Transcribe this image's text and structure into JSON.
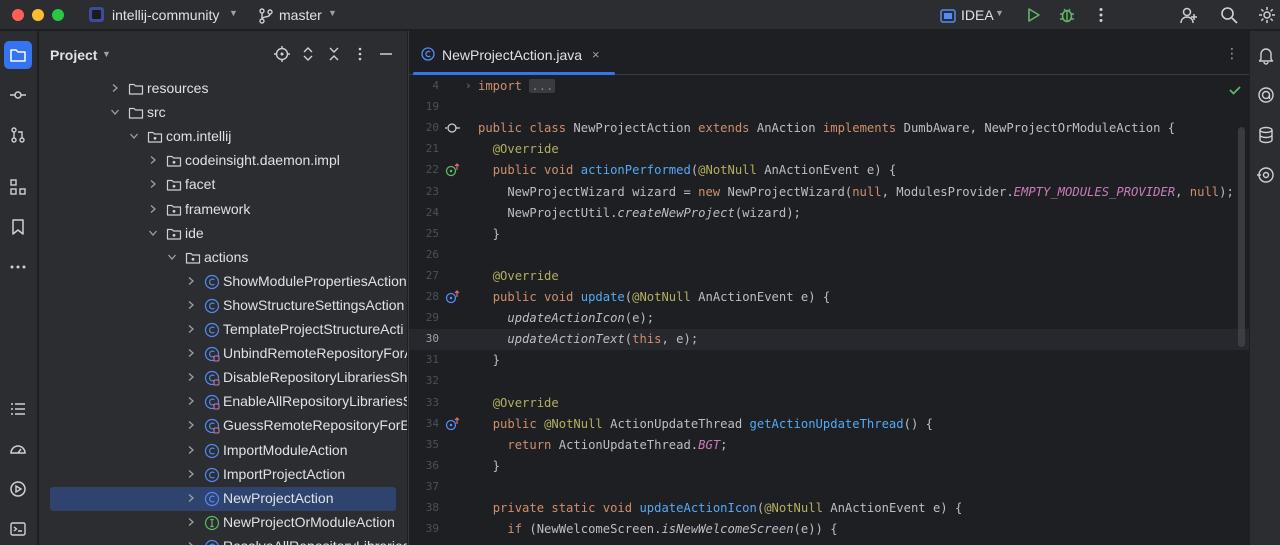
{
  "titlebar": {
    "project_name": "intellij-community",
    "branch": "master",
    "run_config": "IDEA"
  },
  "project_panel": {
    "title": "Project",
    "tree": [
      {
        "label": "resources",
        "icon": "folder-icon",
        "depth": 0,
        "arrow": "collapsed"
      },
      {
        "label": "src",
        "icon": "folder-icon",
        "depth": 0,
        "arrow": "expanded"
      },
      {
        "label": "com.intellij",
        "icon": "package-icon",
        "depth": 1,
        "arrow": "expanded"
      },
      {
        "label": "codeinsight.daemon.impl",
        "icon": "package-icon",
        "depth": 2,
        "arrow": "collapsed"
      },
      {
        "label": "facet",
        "icon": "package-icon",
        "depth": 2,
        "arrow": "collapsed"
      },
      {
        "label": "framework",
        "icon": "package-icon",
        "depth": 2,
        "arrow": "collapsed"
      },
      {
        "label": "ide",
        "icon": "package-icon",
        "depth": 2,
        "arrow": "expanded"
      },
      {
        "label": "actions",
        "icon": "package-icon",
        "depth": 3,
        "arrow": "expanded"
      },
      {
        "label": "ShowModulePropertiesAction",
        "icon": "class-icon",
        "depth": 4,
        "arrow": "collapsed"
      },
      {
        "label": "ShowStructureSettingsAction",
        "icon": "class-icon",
        "depth": 4,
        "arrow": "collapsed"
      },
      {
        "label": "TemplateProjectStructureActi",
        "icon": "class-icon",
        "depth": 4,
        "arrow": "collapsed"
      },
      {
        "label": "UnbindRemoteRepositoryForA",
        "icon": "class-locked-icon",
        "depth": 4,
        "arrow": "collapsed"
      },
      {
        "label": "DisableRepositoryLibrariesSha",
        "icon": "class-locked-icon",
        "depth": 4,
        "arrow": "collapsed"
      },
      {
        "label": "EnableAllRepositoryLibrariesS",
        "icon": "class-locked-icon",
        "depth": 4,
        "arrow": "collapsed"
      },
      {
        "label": "GuessRemoteRepositoryForEa",
        "icon": "class-locked-icon",
        "depth": 4,
        "arrow": "collapsed"
      },
      {
        "label": "ImportModuleAction",
        "icon": "class-icon",
        "depth": 4,
        "arrow": "collapsed"
      },
      {
        "label": "ImportProjectAction",
        "icon": "class-icon",
        "depth": 4,
        "arrow": "collapsed"
      },
      {
        "label": "NewProjectAction",
        "icon": "class-icon",
        "depth": 4,
        "arrow": "collapsed",
        "selected": true
      },
      {
        "label": "NewProjectOrModuleAction",
        "icon": "interface-icon",
        "depth": 4,
        "arrow": "collapsed"
      },
      {
        "label": "ResolveAllRepositoryLibraries",
        "icon": "class-locked-icon",
        "depth": 4,
        "arrow": "collapsed"
      }
    ]
  },
  "editor": {
    "tab_label": "NewProjectAction.java",
    "tab_close": "×",
    "current_line": "30",
    "lines": [
      {
        "n": "4",
        "gutter": "",
        "fold": "›",
        "html": "<span class=\"kw\">import</span> <span class=\"cm\">...</span>"
      },
      {
        "n": "19",
        "gutter": "",
        "html": ""
      },
      {
        "n": "20",
        "gutter": "implements",
        "html": "<span class=\"kw\">public class</span> NewProjectAction <span class=\"kw\">extends</span> AnAction <span class=\"kw\">implements</span> DumbAware, NewProjectOrModuleAction {"
      },
      {
        "n": "21",
        "gutter": "",
        "html": "  <span class=\"an\">@Override</span>"
      },
      {
        "n": "22",
        "gutter": "override-green",
        "html": "  <span class=\"kw\">public void</span> <span class=\"fn\">actionPerformed</span>(<span class=\"an\">@NotNull</span> AnActionEvent e) {"
      },
      {
        "n": "23",
        "gutter": "",
        "html": "    NewProjectWizard wizard = <span class=\"kw\">new</span> NewProjectWizard(<span class=\"kw\">null</span>, ModulesProvider.<span class=\"st\">EMPTY_MODULES_PROVIDER</span>, <span class=\"kw\">null</span>);"
      },
      {
        "n": "24",
        "gutter": "",
        "html": "    NewProjectUtil.<span class=\"it\">createNewProject</span>(wizard);"
      },
      {
        "n": "25",
        "gutter": "",
        "html": "  }"
      },
      {
        "n": "26",
        "gutter": "",
        "html": ""
      },
      {
        "n": "27",
        "gutter": "",
        "html": "  <span class=\"an\">@Override</span>"
      },
      {
        "n": "28",
        "gutter": "override-blue",
        "html": "  <span class=\"kw\">public void</span> <span class=\"fn\">update</span>(<span class=\"an\">@NotNull</span> AnActionEvent e) {"
      },
      {
        "n": "29",
        "gutter": "",
        "html": "    <span class=\"it\">updateActionIcon</span>(e);"
      },
      {
        "n": "30",
        "gutter": "",
        "html": "    <span class=\"it\">updateActionText</span>(<span class=\"kw\">this</span>, e);"
      },
      {
        "n": "31",
        "gutter": "",
        "html": "  }"
      },
      {
        "n": "32",
        "gutter": "",
        "html": ""
      },
      {
        "n": "33",
        "gutter": "",
        "html": "  <span class=\"an\">@Override</span>"
      },
      {
        "n": "34",
        "gutter": "override-blue",
        "html": "  <span class=\"kw\">public</span> <span class=\"an\">@NotNull</span> ActionUpdateThread <span class=\"fn\">getActionUpdateThread</span>() {"
      },
      {
        "n": "35",
        "gutter": "",
        "html": "    <span class=\"kw\">return</span> ActionUpdateThread.<span class=\"st\">BGT</span>;"
      },
      {
        "n": "36",
        "gutter": "",
        "html": "  }"
      },
      {
        "n": "37",
        "gutter": "",
        "html": ""
      },
      {
        "n": "38",
        "gutter": "",
        "html": "  <span class=\"kw\">private static void</span> <span class=\"fn\">updateActionIcon</span>(<span class=\"an\">@NotNull</span> AnActionEvent e) {"
      },
      {
        "n": "39",
        "gutter": "",
        "html": "    <span class=\"kw\">if</span> (NewWelcomeScreen.<span class=\"it\">isNewWelcomeScreen</span>(e)) {"
      }
    ]
  },
  "colors": {
    "accent": "#3574f0",
    "selection": "#2e436e",
    "keyword": "#cf8e6d",
    "annotation": "#b3ae60",
    "function": "#56a8f5",
    "static": "#c77dbb"
  }
}
